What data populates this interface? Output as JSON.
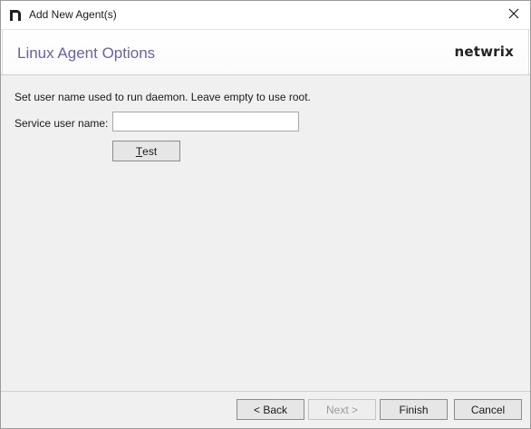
{
  "window": {
    "title": "Add New Agent(s)"
  },
  "header": {
    "page_title": "Linux Agent Options",
    "brand": "netwrix"
  },
  "main": {
    "instruction": "Set user name used to run daemon. Leave empty to use root.",
    "service_user_label": "Service user name:",
    "service_user_value": "",
    "test_button": {
      "mnemonic": "T",
      "rest": "est"
    }
  },
  "footer": {
    "back_label": "< Back",
    "next_label": "Next >",
    "finish_label": "Finish",
    "cancel_label": "Cancel"
  },
  "colors": {
    "accent_title": "#6c5fb0"
  },
  "icons": {
    "app": "netwrix-n-icon",
    "close": "close-icon"
  }
}
